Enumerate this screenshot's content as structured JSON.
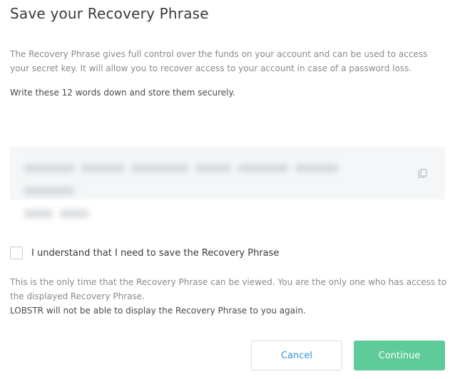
{
  "dialog": {
    "title": "Save your Recovery Phrase",
    "description": "The Recovery Phrase gives full control over the funds on your account and can be used to access your secret key. It will allow you to recover access to your account in case of a password loss.",
    "instruction": "Write these 12 words down and store them securely."
  },
  "phrase_box": {
    "copy_icon": "copy-icon"
  },
  "confirmation": {
    "checkbox_label": "I understand that I need to save the Recovery Phrase",
    "checked": false
  },
  "warning": {
    "line1": "This is the only time that the Recovery Phrase can be viewed. You are the only one who has access to the displayed Recovery Phrase.",
    "line2": "LOBSTR will not be able to display the Recovery Phrase to you again."
  },
  "buttons": {
    "cancel_label": "Cancel",
    "continue_label": "Continue"
  },
  "colors": {
    "accent_blue": "#2f97d8",
    "continue_green": "#5ecb98",
    "phrase_bg": "#f4f6f7"
  }
}
